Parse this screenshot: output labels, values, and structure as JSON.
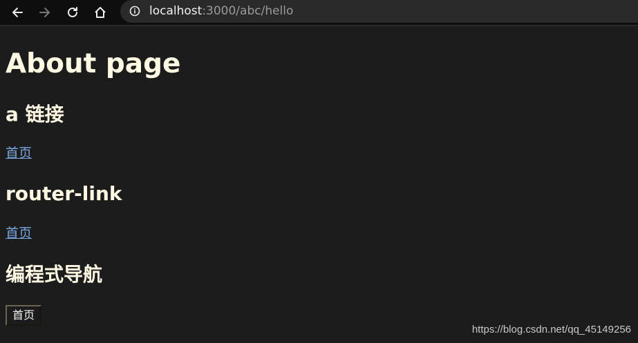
{
  "browser": {
    "url_host": "localhost",
    "url_rest": ":3000/abc/hello",
    "icons": [
      "back-icon",
      "forward-icon",
      "reload-icon",
      "home-icon",
      "info-icon"
    ]
  },
  "page": {
    "title": "About page",
    "section_a": {
      "heading": "a 链接",
      "link": "首页"
    },
    "section_router": {
      "heading": "router-link",
      "link": "首页"
    },
    "section_programmatic": {
      "heading": "编程式导航",
      "button": "首页"
    }
  },
  "watermark": "https://blog.csdn.net/qq_45149256",
  "colors": {
    "background": "#1c1c1c",
    "text": "#fff8e3",
    "link": "#7aa7e0"
  }
}
